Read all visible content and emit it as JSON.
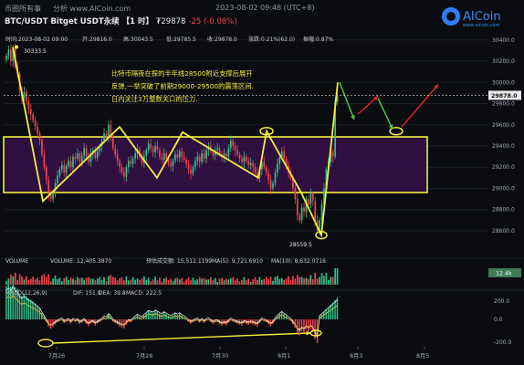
{
  "header": {
    "site_label": "币圈所有事",
    "watermark": "分析 www.AICoin.com",
    "datetime": "2023-08-02 09:48 (UTC+8)",
    "pair": "BTC/USDT Bitget USDT永续",
    "interval": "【1 时】",
    "price": "₮29878",
    "change": "-25 (-0.08%)",
    "logo_text": "AICoin",
    "logo_url": "www.aicoin.com"
  },
  "info_bar": {
    "time": "时间:2023-08-02 09:00",
    "open": "开:29816.0",
    "high": "高:30043.5",
    "low": "低:29785.5",
    "close": "收:29878.0",
    "change": "涨跌:0.21%(62.0)",
    "amplitude": "振幅:0.87%"
  },
  "annotation": {
    "lines": [
      "比特币隔夜在探的半年线28500附近支撑后展开",
      "反弹,一举突破了前期29000-29500的震荡区间.",
      "日内关注3万整数关口的压力."
    ]
  },
  "colors": {
    "up": "#2fc08b",
    "down": "#f0424c",
    "annotation_yellow": "#f3ee3a",
    "box_border": "#f3ee3a",
    "box_fill": "#3b1050",
    "zigzag": "#7a3cd0",
    "green_arrow": "#46d23c",
    "red_arrow": "#e22a2a",
    "price_tag_bg": "#e9e9e9"
  },
  "chart_data": [
    {
      "type": "candlestick",
      "title": "",
      "ylim": [
        28350,
        30450
      ],
      "y_ticks": [
        30400,
        30200,
        30000,
        29800,
        29600,
        29400,
        29200,
        29000,
        28800,
        28600
      ],
      "last_price": "29878.0",
      "x_ticks": [
        "7月26",
        "7月28",
        "7月30",
        "8月1",
        "8月3",
        "8月5"
      ],
      "range_box": {
        "low": 29050,
        "high": 29540
      },
      "marked_levels": [
        {
          "label": "30333.5",
          "value": 30333.5
        },
        {
          "label": "28559.5",
          "value": 28559.5
        }
      ],
      "candle_closes": [
        30250,
        30310,
        30200,
        30330,
        30150,
        30080,
        29920,
        29850,
        29910,
        29820,
        29750,
        29700,
        29640,
        29580,
        29520,
        29460,
        29320,
        29200,
        29080,
        28940,
        28900,
        28960,
        29050,
        29120,
        29180,
        29220,
        29150,
        29210,
        29260,
        29200,
        29300,
        29280,
        29330,
        29250,
        29310,
        29380,
        29300,
        29250,
        29330,
        29360,
        29290,
        29350,
        29400,
        29450,
        29520,
        29480,
        29600,
        29500,
        29380,
        29320,
        29260,
        29200,
        29150,
        29110,
        29200,
        29260,
        29230,
        29280,
        29330,
        29370,
        29300,
        29240,
        29310,
        29360,
        29420,
        29380,
        29340,
        29400,
        29360,
        29300,
        29270,
        29330,
        29280,
        29240,
        29210,
        29260,
        29320,
        29290,
        29350,
        29300,
        29270,
        29230,
        29180,
        29140,
        29200,
        29260,
        29300,
        29250,
        29330,
        29280,
        29360,
        29400,
        29350,
        29310,
        29360,
        29380,
        29320,
        29290,
        29330,
        29300,
        29380,
        29450,
        29400,
        29360,
        29320,
        29280,
        29250,
        29300,
        29260,
        29220,
        29240,
        29200,
        29150,
        29100,
        29180,
        29250,
        29200,
        29150,
        29080,
        29000,
        29050,
        29150,
        29230,
        29300,
        29350,
        29280,
        29220,
        29150,
        29100,
        29000,
        28900,
        28750,
        28700,
        28820,
        28780,
        28900,
        28850,
        28950,
        28880,
        28700,
        28600,
        28700,
        28850,
        29000,
        29180,
        29250,
        29350,
        29300,
        29816,
        29878
      ],
      "volume": {
        "label": "VOLUME",
        "value": "VOLUME: 12,405.3870",
        "forecast": "预估成交额: 15,512.1199",
        "ma5": "MA(5): 9,721.6910",
        "ma10": "MA(10): 8,632.0716",
        "last_tag": "12.4k"
      },
      "macd": {
        "label": "MACD(12,26,9)",
        "dif": "DIF: 151.0",
        "dea": "DEA: 39.8",
        "macd": "MACD: 222.5",
        "y_ticks": [
          "200.0",
          "0.0",
          "-200.0"
        ]
      }
    }
  ]
}
